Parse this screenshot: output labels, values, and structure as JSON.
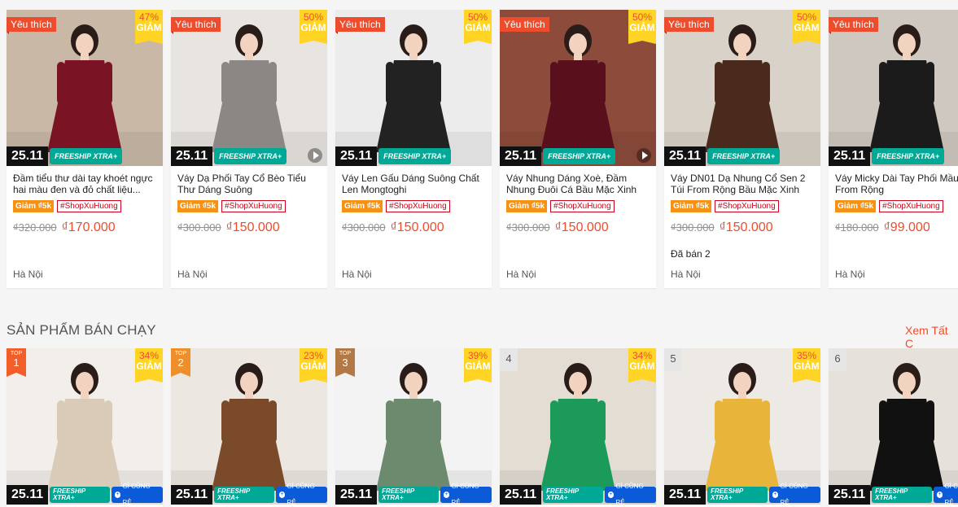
{
  "row1": [
    {
      "fav": "Yêu thích",
      "pct": "47%",
      "off": "GIẢM",
      "date": "25.11",
      "freeship": "FREESHIP XTRA+",
      "title": "Đầm tiểu thư dài tay khoét ngực hai màu đen và đỏ chất liệu...",
      "coupon": "Giảm ₫5k",
      "hashtag": "#ShopXuHuong",
      "old": "₫320.000",
      "new": "₫170.000",
      "sold": "",
      "loc": "Hà Nội",
      "bg": "#c9b8a6",
      "dress": "#7a1424",
      "video": false
    },
    {
      "fav": "Yêu thích",
      "pct": "50%",
      "off": "GIẢM",
      "date": "25.11",
      "freeship": "FREESHIP XTRA+",
      "title": "Váy Dạ Phối Tay Cổ Bèo Tiểu Thư Dáng Suông",
      "coupon": "Giảm ₫5k",
      "hashtag": "#ShopXuHuong",
      "old": "₫300.000",
      "new": "₫150.000",
      "sold": "",
      "loc": "Hà Nội",
      "bg": "#e8e4df",
      "dress": "#8a8784",
      "video": true
    },
    {
      "fav": "Yêu thích",
      "pct": "50%",
      "off": "GIẢM",
      "date": "25.11",
      "freeship": "FREESHIP XTRA+",
      "title": "Váy Len Gấu Dáng Suông Chất Len Mongtoghi",
      "coupon": "Giảm ₫5k",
      "hashtag": "#ShopXuHuong",
      "old": "₫300.000",
      "new": "₫150.000",
      "sold": "",
      "loc": "Hà Nội",
      "bg": "#ececec",
      "dress": "#222222",
      "video": false
    },
    {
      "fav": "Yêu thích",
      "pct": "50%",
      "off": "GIẢM",
      "date": "25.11",
      "freeship": "FREESHIP XTRA+",
      "title": "Váy Nhung Dáng Xoè, Đầm Nhung Đuôi Cá Bầu Mặc Xinh",
      "coupon": "Giảm ₫5k",
      "hashtag": "#ShopXuHuong",
      "old": "₫300.000",
      "new": "₫150.000",
      "sold": "",
      "loc": "Hà Nội",
      "bg": "#8d4b3b",
      "dress": "#5a0f1c",
      "video": true
    },
    {
      "fav": "Yêu thích",
      "pct": "50%",
      "off": "GIẢM",
      "date": "25.11",
      "freeship": "FREESHIP XTRA+",
      "title": "Váy DN01 Dạ Nhung Cổ Sen 2 Túi From Rộng Bầu Mặc Xinh",
      "coupon": "Giảm ₫5k",
      "hashtag": "#ShopXuHuong",
      "old": "₫300.000",
      "new": "₫150.000",
      "sold": "Đã bán 2",
      "loc": "Hà Nội",
      "bg": "#d8d2c8",
      "dress": "#4a2a1c",
      "video": false
    },
    {
      "fav": "Yêu thích",
      "pct": "",
      "off": "",
      "date": "25.11",
      "freeship": "FREESHIP XTRA+",
      "title": "Váy Micky Dài Tay Phối Mầu From Rộng",
      "coupon": "Giảm ₫5k",
      "hashtag": "#ShopXuHuong",
      "old": "₫180.000",
      "new": "₫99.000",
      "sold": "",
      "loc": "Hà Nội",
      "bg": "#cfc8c0",
      "dress": "#1b1b1b",
      "video": false
    }
  ],
  "section": {
    "title": "SẢN PHẨM BÁN CHẠY",
    "see_all": "Xem Tất C"
  },
  "row2": [
    {
      "rank": "1",
      "top": "TOP",
      "pct": "34%",
      "off": "GIẢM",
      "date": "25.11",
      "freeship": "FREESHIP XTRA+",
      "re": "GÌ CŨNG RẺ",
      "bg": "#f2efea",
      "dress": "#d9cbb8"
    },
    {
      "rank": "2",
      "top": "TOP",
      "pct": "23%",
      "off": "GIẢM",
      "date": "25.11",
      "freeship": "FREESHIP XTRA+",
      "re": "GÌ CŨNG RẺ",
      "bg": "#ece7e1",
      "dress": "#7a4a2a"
    },
    {
      "rank": "3",
      "top": "TOP",
      "pct": "39%",
      "off": "GIẢM",
      "date": "25.11",
      "freeship": "FREESHIP XTRA+",
      "re": "GÌ CŨNG RẺ",
      "bg": "#f3f3f3",
      "dress": "#6b8a6e"
    },
    {
      "rank": "4",
      "top": "",
      "pct": "34%",
      "off": "GIẢM",
      "date": "25.11",
      "freeship": "FREESHIP XTRA+",
      "re": "GÌ CŨNG RẺ",
      "bg": "#e3ddd4",
      "dress": "#1c9a5a"
    },
    {
      "rank": "5",
      "top": "",
      "pct": "35%",
      "off": "GIẢM",
      "date": "25.11",
      "freeship": "FREESHIP XTRA+",
      "re": "GÌ CŨNG RẺ",
      "bg": "#ede9e4",
      "dress": "#e8b43a"
    },
    {
      "rank": "6",
      "top": "",
      "pct": "",
      "off": "",
      "date": "25.11",
      "freeship": "FREESHIP XTRA+",
      "re": "GÌ CŨNG RẺ",
      "bg": "#e6e1da",
      "dress": "#111111"
    }
  ]
}
